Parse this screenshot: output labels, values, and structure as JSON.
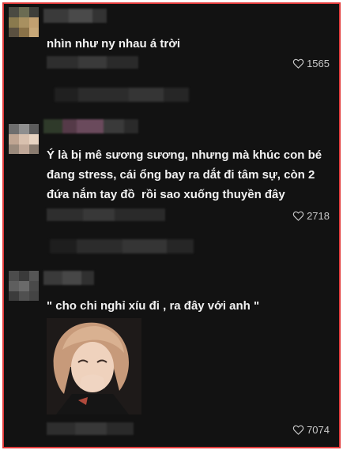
{
  "comments": [
    {
      "text": "nhìn như ny nhau á trời",
      "likes": "1565"
    },
    {
      "text": "Ý là bị mê sương sương, nhưng mà khúc con bé đang stress, cái ổng bay ra dắt đi tâm sự, còn 2 đứa nắm tay đồ  rồi sao xuống thuyền đây",
      "likes": "2718"
    },
    {
      "text": "\" cho chi nghỉ xíu đi , ra đây với anh \"",
      "likes": "7074"
    }
  ],
  "icons": {
    "like": "heart-outline-icon"
  },
  "colors": {
    "background": "#121212",
    "text": "#f2f2f2",
    "muted": "#c8c8c8",
    "border": "#e23b3b"
  }
}
